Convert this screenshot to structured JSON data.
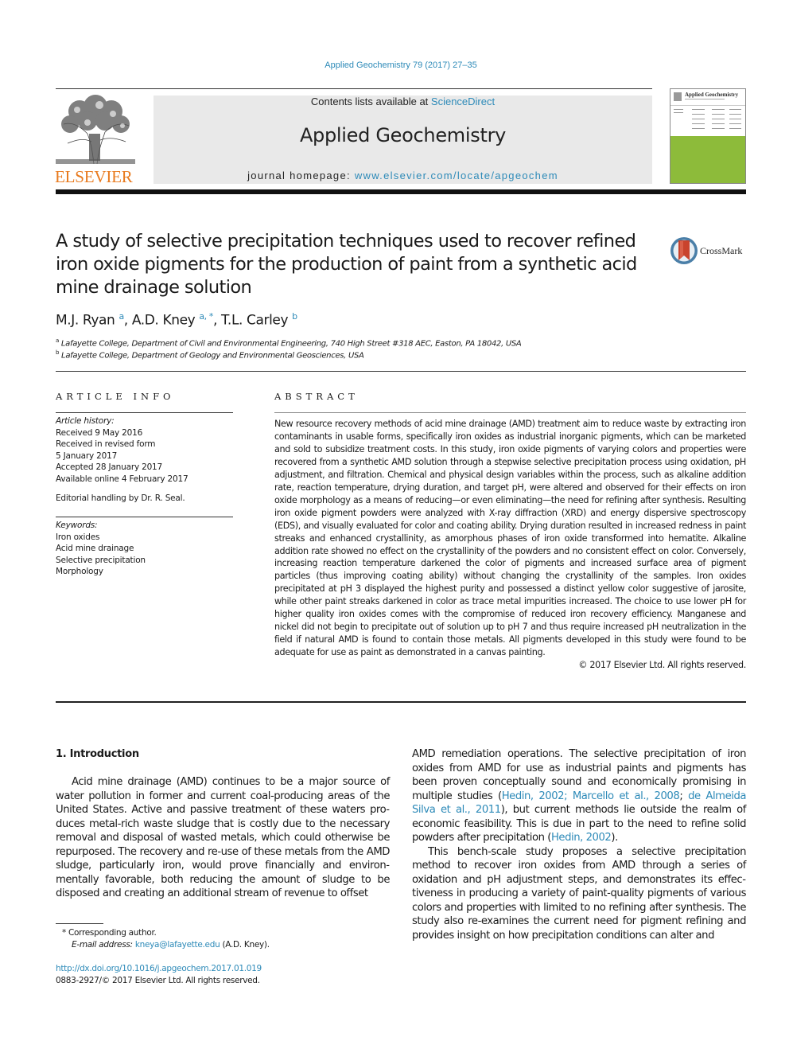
{
  "header": {
    "citation": "Applied Geochemistry 79 (2017) 27–35",
    "publisher_wordmark": "ELSEVIER",
    "contents_prefix": "Contents lists available at ",
    "contents_link": "ScienceDirect",
    "journal_title": "Applied Geochemistry",
    "homepage_prefix": "journal homepage: ",
    "homepage_link": "www.elsevier.com/locate/apgeochem",
    "cover_title": "Applied Geochemistry",
    "crossmark_label": "CrossMark"
  },
  "article": {
    "title": "A study of selective precipitation techniques used to recover refined iron oxide pigments for the production of paint from a synthetic acid mine drainage solution",
    "authors": [
      {
        "name": "M.J. Ryan",
        "sup": "a"
      },
      {
        "name": "A.D. Kney",
        "sup": "a, *"
      },
      {
        "name": "T.L. Carley",
        "sup": "b"
      }
    ],
    "affiliations": [
      {
        "sup": "a",
        "text": "Lafayette College, Department of Civil and Environmental Engineering, 740 High Street #318 AEC, Easton, PA 18042, USA"
      },
      {
        "sup": "b",
        "text": "Lafayette College, Department of Geology and Environmental Geosciences, USA"
      }
    ]
  },
  "article_info": {
    "label": "ARTICLE INFO",
    "history_label": "Article history:",
    "history": [
      "Received 9 May 2016",
      "Received in revised form",
      "5 January 2017",
      "Accepted 28 January 2017",
      "Available online 4 February 2017"
    ],
    "editorial": "Editorial handling by Dr. R. Seal.",
    "keywords_label": "Keywords:",
    "keywords": [
      "Iron oxides",
      "Acid mine drainage",
      "Selective precipitation",
      "Morphology"
    ]
  },
  "abstract": {
    "label": "ABSTRACT",
    "text": "New resource recovery methods of acid mine drainage (AMD) treatment aim to reduce waste by extracting iron contaminants in usable forms, specifically iron oxides as industrial inorganic pigments, which can be marketed and sold to subsidize treatment costs. In this study, iron oxide pigments of varying colors and properties were recovered from a synthetic AMD solution through a stepwise se­lective precipitation process using oxidation, pH adjustment, and filtration. Chemical and physical design variables within the process, such as alkaline addition rate, reaction temperature, drying duration, and target pH, were altered and observed for their effects on iron oxide morphology as a means of reduc­ing—or even eliminating—the need for refining after synthesis. Resulting iron oxide pigment powders were analyzed with X-ray diffraction (XRD) and energy dispersive spectroscopy (EDS), and visually evaluated for color and coating ability. Drying duration resulted in increased redness in paint streaks and enhanced crystallinity, as amorphous phases of iron oxide transformed into hematite. Alkaline addition rate showed no effect on the crystallinity of the powders and no consistent effect on color. Conversely, increasing reaction temperature darkened the color of pigments and increased surface area of pigment particles (thus improving coating ability) without changing the crystallinity of the samples. Iron oxides precipitated at pH 3 displayed the highest purity and possessed a distinct yellow color suggestive of jarosite, while other paint streaks darkened in color as trace metal impurities increased. The choice to use lower pH for higher quality iron oxides comes with the compromise of reduced iron recovery effi­ciency. Manganese and nickel did not begin to precipitate out of solution up to pH 7 and thus require increased pH neutralization in the field if natural AMD is found to contain those metals. All pigments developed in this study were found to be adequate for use as paint as demonstrated in a canvas painting.",
    "copyright": "© 2017 Elsevier Ltd. All rights reserved."
  },
  "introduction": {
    "heading": "1.  Introduction",
    "col1_p1": "Acid mine drainage (AMD) continues to be a major source of water pollution in former and current coal-producing areas of the United States. Active and passive treatment of these waters pro­duces metal-rich waste sludge that is costly due to the necessary removal and disposal of wasted metals, which could otherwise be repurposed. The recovery and re-use of these metals from the AMD sludge, particularly iron, would prove financially and environ­mentally favorable, both reducing the amount of sludge to be disposed and creating an additional stream of revenue to offset",
    "col2_p1_a": "AMD remediation operations. The selective precipitation of iron oxides from AMD for use as industrial paints and pigments has been proven conceptually sound and economically promising in multiple studies (",
    "col2_ref1": "Hedin, 2002; Marcello et al., 2008",
    "col2_sep": "; ",
    "col2_ref2": "de Almeida Silva et al., 2011",
    "col2_p1_b": "), but current methods lie outside the realm of economic feasibility. This is due in part to the need to refine solid powders after precipitation (",
    "col2_ref3": "Hedin, 2002",
    "col2_p1_c": ").",
    "col2_p2": "This bench-scale study proposes a selective precipitation method to recover iron oxides from AMD through a series of oxidation and pH adjustment steps, and demonstrates its effec­tiveness in producing a variety of paint-quality pigments of various colors and properties with limited to no refining after synthesis. The study also re-examines the current need for pigment refining and provides insight on how precipitation conditions can alter and"
  },
  "footnotes": {
    "corresponding": "*  Corresponding author.",
    "email_label": "E-mail address: ",
    "email": "kneya@lafayette.edu",
    "email_owner": " (A.D. Kney).",
    "doi": "http://dx.doi.org/10.1016/j.apgeochem.2017.01.019",
    "issn": "0883-2927/© 2017 Elsevier Ltd. All rights reserved."
  }
}
